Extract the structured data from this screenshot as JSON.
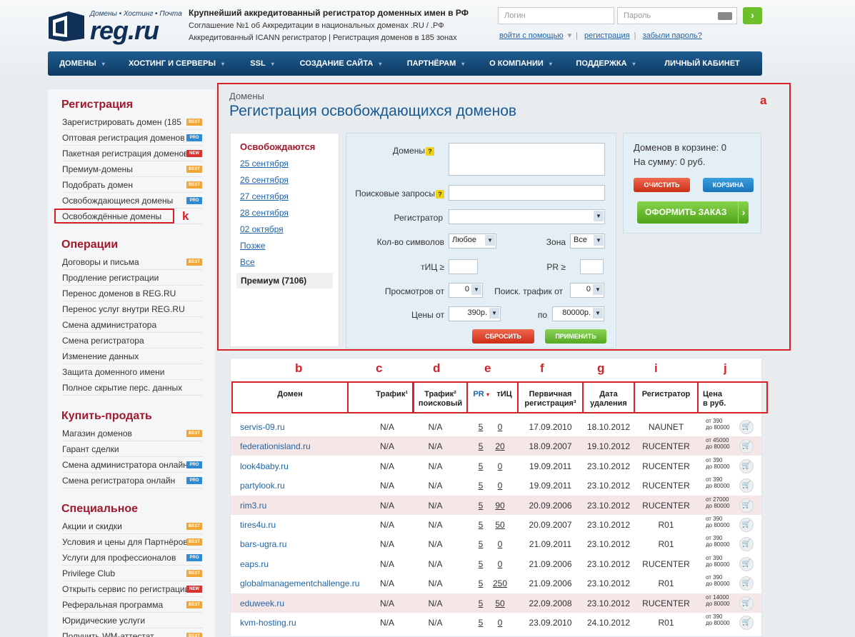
{
  "header": {
    "logo_tagline": "Домены • Хостинг • Почта",
    "logo_name": "reg.ru",
    "tagline1": "Крупнейший аккредитованный регистратор доменных имен в РФ",
    "tagline2": "Соглашение №1 об Аккредитации в национальных доменах .RU / .РФ",
    "tagline3": "Аккредитованный ICANN регистратор | Регистрация доменов в 185 зонах",
    "login_placeholder": "Логин",
    "password_placeholder": "Пароль",
    "login_help": "войти с помощью",
    "register": "регистрация",
    "forgot": "забыли пароль?"
  },
  "nav": [
    "ДОМЕНЫ",
    "ХОСТИНГ И СЕРВЕРЫ",
    "SSL",
    "СОЗДАНИЕ САЙТА",
    "ПАРТНЁРАМ",
    "О КОМПАНИИ",
    "ПОДДЕРЖКА",
    "ЛИЧНЫЙ КАБИНЕТ"
  ],
  "sidebar": {
    "reg_title": "Регистрация",
    "reg": [
      "Зарегистрировать домен (185",
      "Оптовая регистрация доменов",
      "Пакетная регистрация доменов",
      "Премиум-домены",
      "Подобрать домен",
      "Освобождающиеся домены",
      "Освобождённые домены"
    ],
    "ops_title": "Операции",
    "ops": [
      "Договоры и письма",
      "Продление регистрации",
      "Перенос доменов в REG.RU",
      "Перенос услуг внутри REG.RU",
      "Смена администратора",
      "Смена регистратора",
      "Изменение данных",
      "Защита доменного имени",
      "Полное скрытие перс. данных"
    ],
    "buy_title": "Купить-продать",
    "buy": [
      "Магазин доменов",
      "Гарант сделки",
      "Смена администратора онлайн",
      "Смена регистратора онлайн"
    ],
    "spec_title": "Специальное",
    "spec": [
      "Акции и скидки",
      "Условия и цены для Партнёров",
      "Услуги для профессионалов",
      "Privilege Club",
      "Открыть сервис по регистрации",
      "Реферальная программа",
      "Юридические услуги",
      "Получить WM-аттестат"
    ],
    "badge_best": "BEST",
    "badge_pro": "PRO",
    "badge_new": "NEW"
  },
  "labels": {
    "a": "a",
    "b": "b",
    "c": "c",
    "d": "d",
    "e": "e",
    "f": "f",
    "g": "g",
    "i": "i",
    "j": "j",
    "k": "k"
  },
  "main": {
    "breadcrumb": "Домены",
    "title": "Регистрация освобождающихся доменов",
    "dates_title": "Освобождаются",
    "dates": [
      "25 сентября",
      "26 сентября",
      "27 сентября",
      "28 сентября",
      "02 октября",
      "Позже",
      "Все"
    ],
    "premium": "Премиум (7106)"
  },
  "form": {
    "domains": "Домены",
    "queries": "Поисковые запросы",
    "registrar": "Регистратор",
    "chars": "Кол-во символов",
    "chars_val": "Любое",
    "zone": "Зона",
    "zone_val": "Все",
    "tic": "тИЦ ≥",
    "pr": "PR ≥",
    "views": "Просмотров от",
    "views_val": "0",
    "traffic": "Поиск. трафик от",
    "traffic_val": "0",
    "price_from": "Цены от",
    "price_from_val": "390р.",
    "price_to": "по",
    "price_to_val": "80000р.",
    "reset": "СБРОСИТЬ",
    "apply": "ПРИМЕНИТЬ"
  },
  "cart": {
    "count": "Доменов в корзине: 0",
    "sum": "На сумму:  0 руб.",
    "clear": "ОЧИСТИТЬ",
    "cart": "КОРЗИНА",
    "order": "ОФОРМИТЬ ЗАКАЗ"
  },
  "table": {
    "headers": {
      "domain": "Домен",
      "traffic1": "Трафик¹",
      "traffic2a": "Трафик²",
      "traffic2b": "поисковый",
      "pr": "PR",
      "tic": "тИЦ",
      "first_a": "Первичная",
      "first_b": "регистрация³",
      "del_a": "Дата",
      "del_b": "удаления",
      "registrar": "Регистратор",
      "price_a": "Цена",
      "price_b": "в руб."
    },
    "rows": [
      {
        "domain": "servis-09.ru",
        "t1": "N/A",
        "t2": "N/A",
        "pr": "5",
        "tic": "0",
        "first": "17.09.2010",
        "del": "18.10.2012",
        "reg": "NAUNET",
        "p1": "от 390",
        "p2": "до 80000",
        "pink": false
      },
      {
        "domain": "federationisland.ru",
        "t1": "N/A",
        "t2": "N/A",
        "pr": "5",
        "tic": "20",
        "first": "18.09.2007",
        "del": "19.10.2012",
        "reg": "RUCENTER",
        "p1": "от 45000",
        "p2": "до 80000",
        "pink": true
      },
      {
        "domain": "look4baby.ru",
        "t1": "N/A",
        "t2": "N/A",
        "pr": "5",
        "tic": "0",
        "first": "19.09.2011",
        "del": "23.10.2012",
        "reg": "RUCENTER",
        "p1": "от 390",
        "p2": "до 80000",
        "pink": false
      },
      {
        "domain": "partylook.ru",
        "t1": "N/A",
        "t2": "N/A",
        "pr": "5",
        "tic": "0",
        "first": "19.09.2011",
        "del": "23.10.2012",
        "reg": "RUCENTER",
        "p1": "от 390",
        "p2": "до 80000",
        "pink": false
      },
      {
        "domain": "rim3.ru",
        "t1": "N/A",
        "t2": "N/A",
        "pr": "5",
        "tic": "90",
        "first": "20.09.2006",
        "del": "23.10.2012",
        "reg": "RUCENTER",
        "p1": "от 27000",
        "p2": "до 80000",
        "pink": true
      },
      {
        "domain": "tires4u.ru",
        "t1": "N/A",
        "t2": "N/A",
        "pr": "5",
        "tic": "50",
        "first": "20.09.2007",
        "del": "23.10.2012",
        "reg": "R01",
        "p1": "от 390",
        "p2": "до 80000",
        "pink": false
      },
      {
        "domain": "bars-ugra.ru",
        "t1": "N/A",
        "t2": "N/A",
        "pr": "5",
        "tic": "0",
        "first": "21.09.2011",
        "del": "23.10.2012",
        "reg": "R01",
        "p1": "от 390",
        "p2": "до 80000",
        "pink": false
      },
      {
        "domain": "eaps.ru",
        "t1": "N/A",
        "t2": "N/A",
        "pr": "5",
        "tic": "0",
        "first": "21.09.2006",
        "del": "23.10.2012",
        "reg": "RUCENTER",
        "p1": "от 390",
        "p2": "до 80000",
        "pink": false
      },
      {
        "domain": "globalmanagementchallenge.ru",
        "t1": "N/A",
        "t2": "N/A",
        "pr": "5",
        "tic": "250",
        "first": "21.09.2006",
        "del": "23.10.2012",
        "reg": "R01",
        "p1": "от 390",
        "p2": "до 80000",
        "pink": false
      },
      {
        "domain": "eduweek.ru",
        "t1": "N/A",
        "t2": "N/A",
        "pr": "5",
        "tic": "50",
        "first": "22.09.2008",
        "del": "23.10.2012",
        "reg": "RUCENTER",
        "p1": "от 14000",
        "p2": "до 80000",
        "pink": true
      },
      {
        "domain": "kvm-hosting.ru",
        "t1": "N/A",
        "t2": "N/A",
        "pr": "5",
        "tic": "0",
        "first": "23.09.2010",
        "del": "24.10.2012",
        "reg": "R01",
        "p1": "от 390",
        "p2": "до 80000",
        "pink": false
      }
    ]
  },
  "colors": {
    "brand": "#0f2f57",
    "accent_red": "#a0192c",
    "annotation": "#d52128",
    "link": "#1e64a8"
  }
}
